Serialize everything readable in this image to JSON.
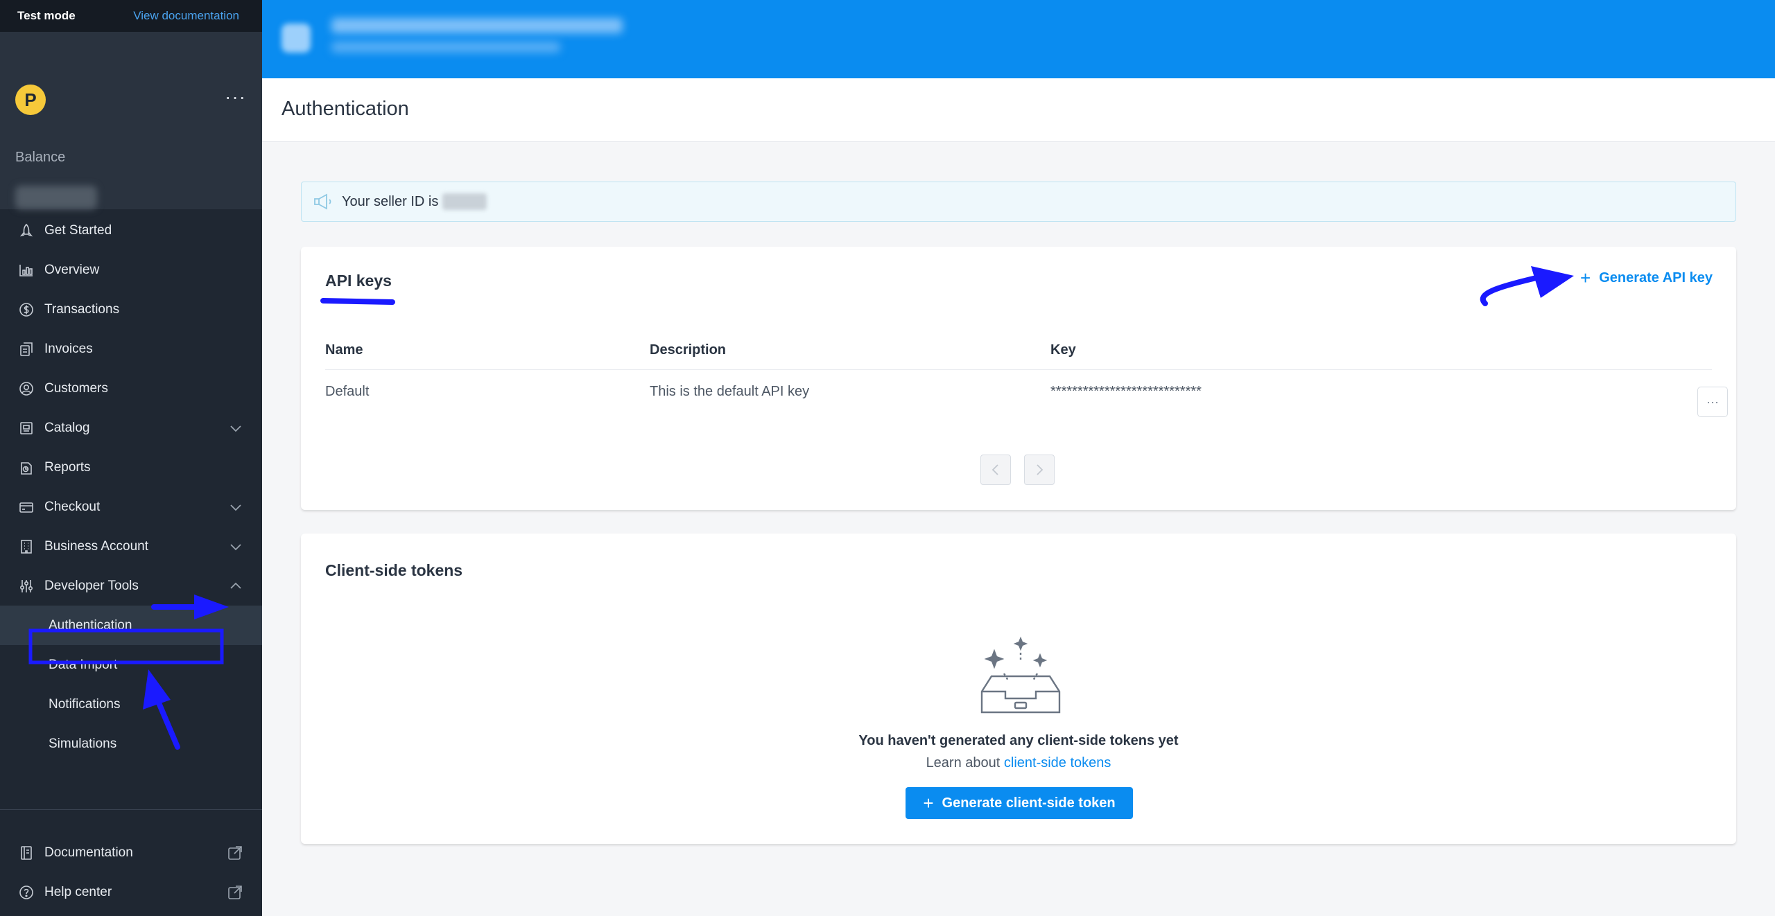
{
  "topbar": {
    "mode": "Test mode",
    "docs_link": "View documentation"
  },
  "brand": {
    "logo_letter": "P",
    "more_label": "···"
  },
  "balance": {
    "label": "Balance"
  },
  "nav": [
    {
      "label": "Get Started",
      "icon": "rocket-icon"
    },
    {
      "label": "Overview",
      "icon": "bar-chart-icon"
    },
    {
      "label": "Transactions",
      "icon": "dollar-icon"
    },
    {
      "label": "Invoices",
      "icon": "invoice-icon"
    },
    {
      "label": "Customers",
      "icon": "user-circle-icon"
    },
    {
      "label": "Catalog",
      "icon": "catalog-icon"
    },
    {
      "label": "Reports",
      "icon": "report-icon"
    },
    {
      "label": "Checkout",
      "icon": "card-icon"
    },
    {
      "label": "Business Account",
      "icon": "building-icon"
    },
    {
      "label": "Developer Tools",
      "icon": "sliders-icon"
    }
  ],
  "dev_tools_sub": [
    "Authentication",
    "Data Import",
    "Notifications",
    "Simulations"
  ],
  "bottom_nav": [
    {
      "label": "Documentation",
      "icon": "book-icon"
    },
    {
      "label": "Help center",
      "icon": "help-icon"
    }
  ],
  "page": {
    "title": "Authentication"
  },
  "notice": {
    "text": "Your seller ID is"
  },
  "api_keys": {
    "title": "API keys",
    "generate_label": "Generate API key",
    "columns": [
      "Name",
      "Description",
      "Key"
    ],
    "rows": [
      {
        "name": "Default",
        "description": "This is the default API key",
        "key": "****************************"
      }
    ],
    "row_menu_label": "···"
  },
  "client_tokens": {
    "title": "Client-side tokens",
    "empty_title": "You haven't generated any client-side tokens yet",
    "learn_prefix": "Learn about",
    "learn_link": "client-side tokens",
    "button_label": "Generate client-side token"
  },
  "colors": {
    "sidebar": "#1f2732",
    "accent": "#0a8cf0",
    "annotation": "#1a1aff",
    "logo": "#f6c93a"
  }
}
